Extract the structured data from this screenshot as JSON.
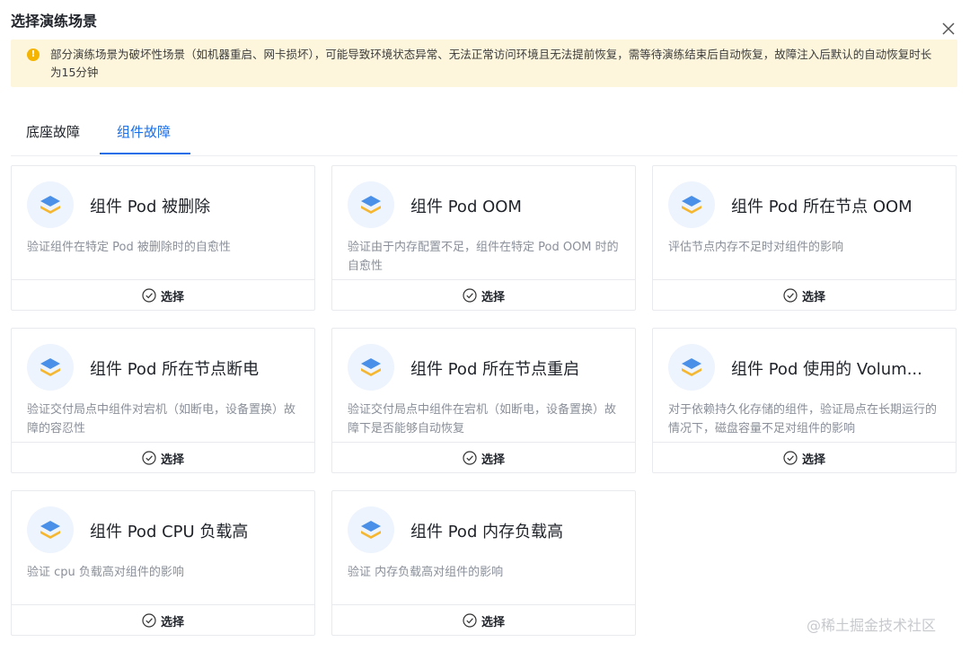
{
  "dialog": {
    "title": "选择演练场景",
    "close_icon": "close-icon"
  },
  "alert": {
    "icon": "warning-icon",
    "text": "部分演练场景为破坏性场景（如机器重启、网卡损坏），可能导致环境状态异常、无法正常访问环境且无法提前恢复，需等待演练结束后自动恢复，故障注入后默认的自动恢复时长为15分钟"
  },
  "tabs": [
    {
      "label": "底座故障",
      "active": false
    },
    {
      "label": "组件故障",
      "active": true
    }
  ],
  "cards": [
    {
      "title": "组件 Pod 被删除",
      "desc": "验证组件在特定 Pod 被删除时的自愈性",
      "action": "选择",
      "icon": "layers-icon"
    },
    {
      "title": "组件 Pod OOM",
      "desc": "验证由于内存配置不足，组件在特定 Pod OOM 时的自愈性",
      "action": "选择",
      "icon": "layers-icon"
    },
    {
      "title": "组件 Pod 所在节点 OOM",
      "desc": "评估节点内存不足时对组件的影响",
      "action": "选择",
      "icon": "layers-icon"
    },
    {
      "title": "组件 Pod 所在节点断电",
      "desc": "验证交付局点中组件对宕机（如断电，设备置换）故障的容忍性",
      "action": "选择",
      "icon": "layers-icon"
    },
    {
      "title": "组件 Pod 所在节点重启",
      "desc": "验证交付局点中组件在宕机（如断电，设备置换）故障下是否能够自动恢复",
      "action": "选择",
      "icon": "layers-icon"
    },
    {
      "title": "组件 Pod 使用的 Volum...",
      "desc": "对于依赖持久化存储的组件，验证局点在长期运行的情况下，磁盘容量不足对组件的影响",
      "action": "选择",
      "icon": "layers-icon"
    },
    {
      "title": "组件 Pod CPU 负载高",
      "desc": "验证 cpu 负载高对组件的影响",
      "action": "选择",
      "icon": "layers-icon"
    },
    {
      "title": "组件 Pod 内存负载高",
      "desc": "验证 内存负载高对组件的影响",
      "action": "选择",
      "icon": "layers-icon"
    }
  ],
  "watermark": "@稀土掘金技术社区",
  "colors": {
    "accent": "#1a6ee8",
    "alert_bg": "#fdf6dc",
    "warning": "#f4b400",
    "icon_blue": "#4a90e8",
    "icon_yellow": "#f5b730"
  }
}
